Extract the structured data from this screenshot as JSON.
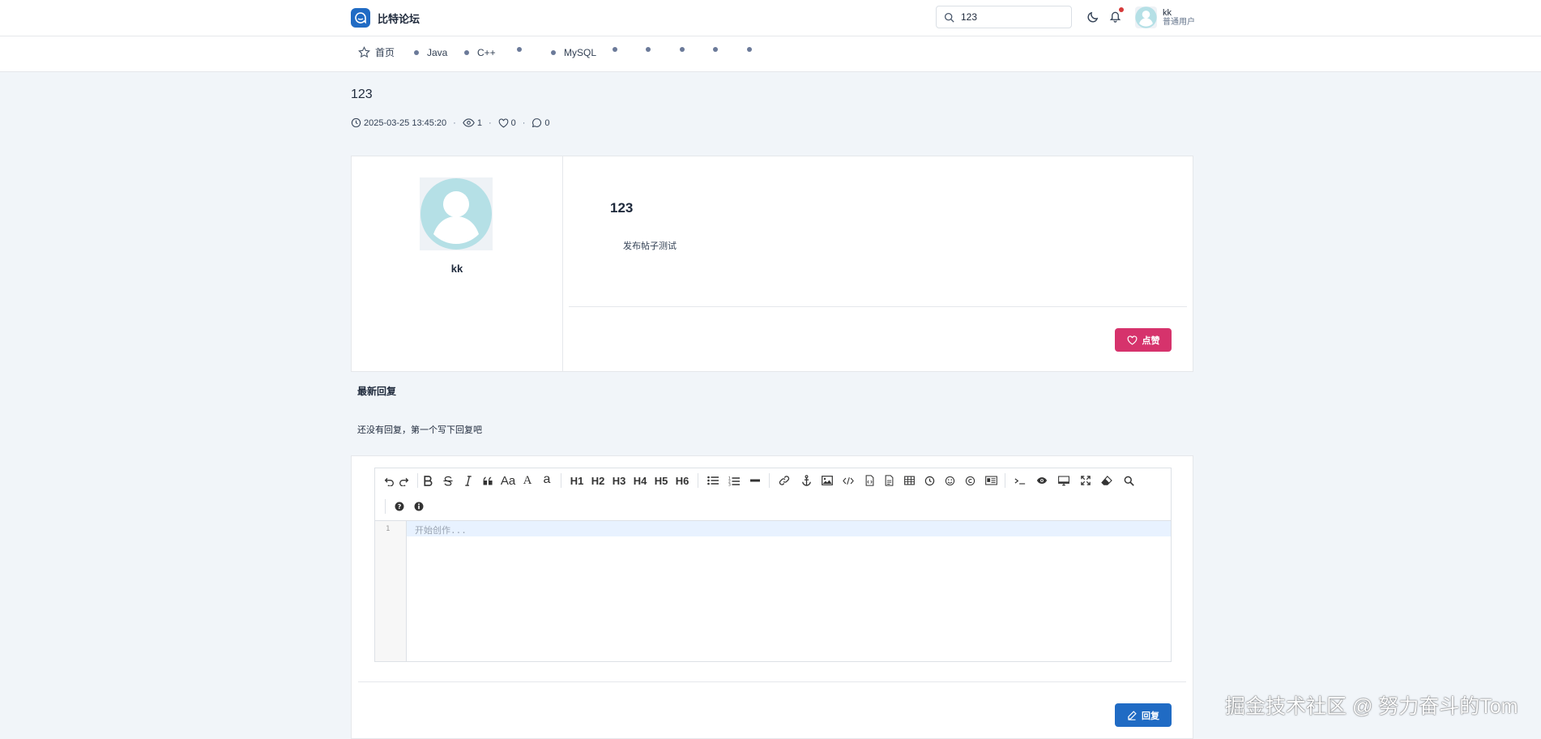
{
  "header": {
    "brand_name": "比特论坛",
    "search_value": "123",
    "user": {
      "name": "kk",
      "role": "普通用户"
    }
  },
  "nav": {
    "home_label": "首页",
    "items": [
      "Java",
      "C++",
      "",
      "MySQL",
      "",
      "",
      "",
      "",
      ""
    ]
  },
  "post": {
    "title": "123",
    "created_at": "2025-03-25 13:45:20",
    "views": "1",
    "likes": "0",
    "comments": "0",
    "author_name": "kk",
    "content_title": "123",
    "content_body": "发布帖子测试",
    "like_label": "点赞"
  },
  "replies": {
    "section_title": "最新回复",
    "empty_text": "还没有回复，第一个写下回复吧"
  },
  "editor": {
    "toolbar_text": {
      "aa": "Aa",
      "a_upper": "A",
      "a_lower": "a",
      "h1": "H1",
      "h2": "H2",
      "h3": "H3",
      "h4": "H4",
      "h5": "H5",
      "h6": "H6"
    },
    "line_number": "1",
    "placeholder": "开始创作...",
    "reply_label": "回复"
  },
  "watermark": "掘金技术社区 @ 努力奋斗的Tom",
  "colors": {
    "primary": "#206bc4",
    "like": "#d6336c",
    "background": "#f1f5f9",
    "notification": "#d63939"
  }
}
